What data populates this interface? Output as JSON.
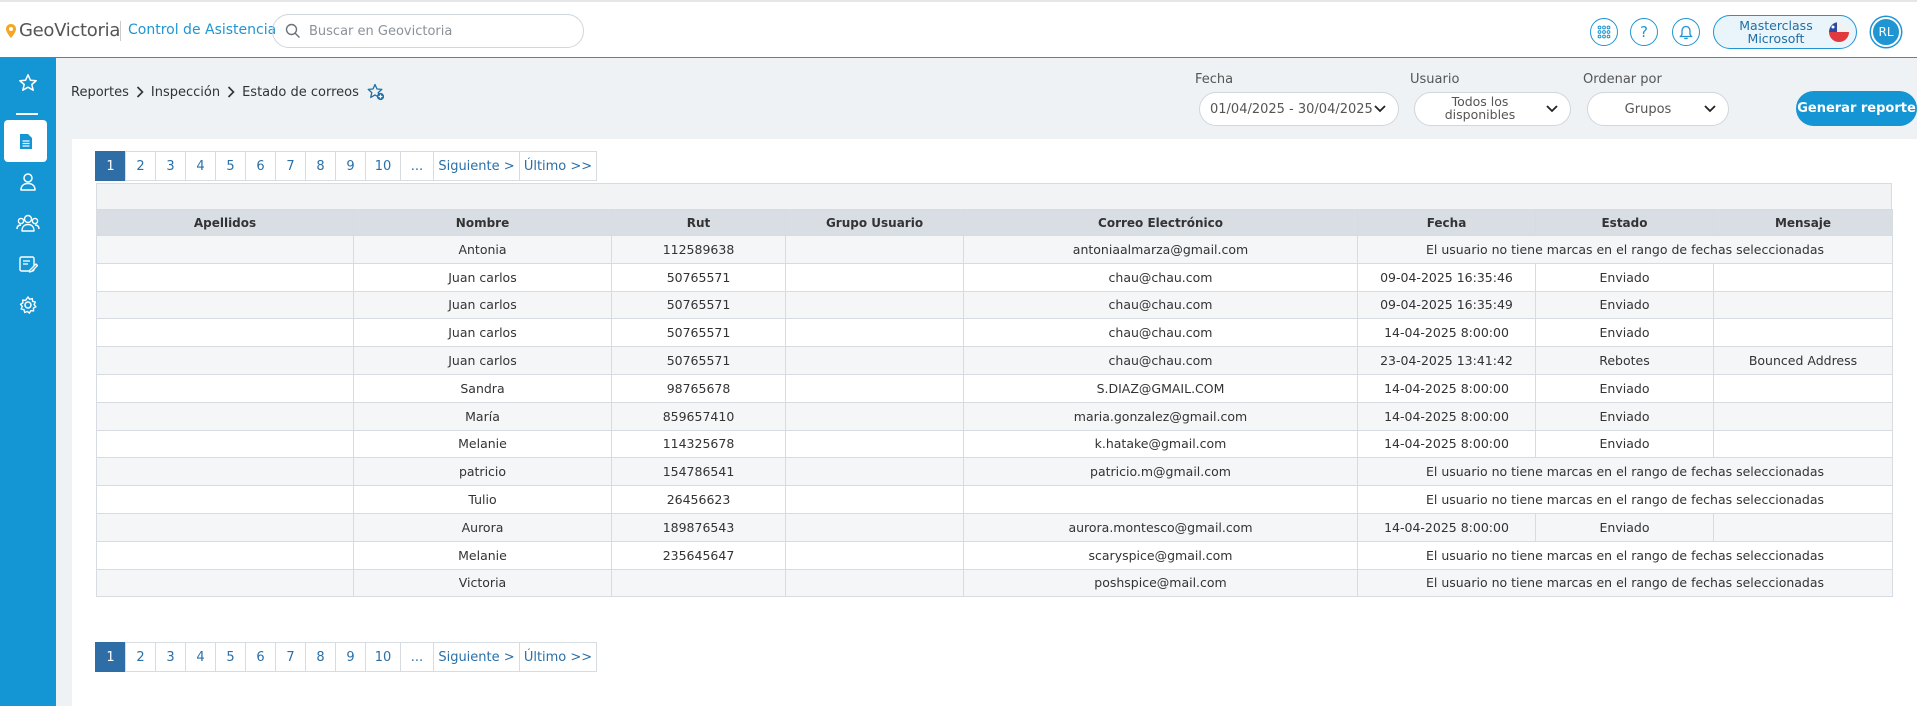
{
  "header": {
    "logo_text": "GeoVictoria",
    "app_name": "Control de Asistencia",
    "search_placeholder": "Buscar en Geovictoria",
    "account_name": "Masterclass Microsoft",
    "avatar_initials": "RL",
    "icons": [
      "apps-grid-icon",
      "help-icon",
      "bell-icon"
    ]
  },
  "sidebar": {
    "items": [
      {
        "name": "favorites",
        "icon": "star-icon"
      },
      {
        "name": "reports",
        "icon": "document-icon",
        "active": true
      },
      {
        "name": "user",
        "icon": "user-icon"
      },
      {
        "name": "groups",
        "icon": "users-icon"
      },
      {
        "name": "schedule-edit",
        "icon": "edit-calendar-icon"
      },
      {
        "name": "settings",
        "icon": "gear-icon"
      }
    ]
  },
  "breadcrumb": [
    "Reportes",
    "Inspección",
    "Estado de correos"
  ],
  "filters": {
    "fecha_label": "Fecha",
    "fecha_value": "01/04/2025 - 30/04/2025",
    "usuario_label": "Usuario",
    "usuario_value": "Todos los disponibles",
    "ordenar_label": "Ordenar por",
    "ordenar_value": "Grupos",
    "generate_label": "Generar reporte"
  },
  "pagination": {
    "pages": [
      "1",
      "2",
      "3",
      "4",
      "5",
      "6",
      "7",
      "8",
      "9",
      "10",
      "..."
    ],
    "current": "1",
    "next_label": "Siguiente >",
    "last_label": "Último >>"
  },
  "table": {
    "columns": [
      "Apellidos",
      "Nombre",
      "Rut",
      "Grupo Usuario",
      "Correo Electrónico",
      "Fecha",
      "Estado",
      "Mensaje"
    ],
    "rows": [
      {
        "apellidos": "",
        "nombre": "Antonia",
        "rut": "112589638",
        "grupo": "",
        "correo": "antoniaalmarza@gmail.com",
        "note": "El usuario no tiene marcas en el rango de fechas seleccionadas"
      },
      {
        "apellidos": "",
        "nombre": "Juan carlos",
        "rut": "50765571",
        "grupo": "",
        "correo": "chau@chau.com",
        "fecha": "09-04-2025 16:35:46",
        "estado": "Enviado",
        "mensaje": ""
      },
      {
        "apellidos": "",
        "nombre": "Juan carlos",
        "rut": "50765571",
        "grupo": "",
        "correo": "chau@chau.com",
        "fecha": "09-04-2025 16:35:49",
        "estado": "Enviado",
        "mensaje": ""
      },
      {
        "apellidos": "",
        "nombre": "Juan carlos",
        "rut": "50765571",
        "grupo": "",
        "correo": "chau@chau.com",
        "fecha": "14-04-2025 8:00:00",
        "estado": "Enviado",
        "mensaje": ""
      },
      {
        "apellidos": "",
        "nombre": "Juan carlos",
        "rut": "50765571",
        "grupo": "",
        "correo": "chau@chau.com",
        "fecha": "23-04-2025 13:41:42",
        "estado": "Rebotes",
        "mensaje": "Bounced Address"
      },
      {
        "apellidos": "",
        "nombre": "Sandra",
        "rut": "98765678",
        "grupo": "",
        "correo": "S.DIAZ@GMAIL.COM",
        "fecha": "14-04-2025 8:00:00",
        "estado": "Enviado",
        "mensaje": ""
      },
      {
        "apellidos": "",
        "nombre": "María",
        "rut": "859657410",
        "grupo": "",
        "correo": "maria.gonzalez@gmail.com",
        "fecha": "14-04-2025 8:00:00",
        "estado": "Enviado",
        "mensaje": ""
      },
      {
        "apellidos": "",
        "nombre": "Melanie",
        "rut": "114325678",
        "grupo": "",
        "correo": "k.hatake@gmail.com",
        "fecha": "14-04-2025 8:00:00",
        "estado": "Enviado",
        "mensaje": ""
      },
      {
        "apellidos": "",
        "nombre": "patricio",
        "rut": "154786541",
        "grupo": "",
        "correo": "patricio.m@gmail.com",
        "note": "El usuario no tiene marcas en el rango de fechas seleccionadas"
      },
      {
        "apellidos": "",
        "nombre": "Tulio",
        "rut": "26456623",
        "grupo": "",
        "correo": "",
        "note": "El usuario no tiene marcas en el rango de fechas seleccionadas"
      },
      {
        "apellidos": "",
        "nombre": "Aurora",
        "rut": "189876543",
        "grupo": "",
        "correo": "aurora.montesco@gmail.com",
        "fecha": "14-04-2025 8:00:00",
        "estado": "Enviado",
        "mensaje": ""
      },
      {
        "apellidos": "",
        "nombre": "Melanie",
        "rut": "235645647",
        "grupo": "",
        "correo": "scaryspice@gmail.com",
        "note": "El usuario no tiene marcas en el rango de fechas seleccionadas"
      },
      {
        "apellidos": "",
        "nombre": "Victoria",
        "rut": "",
        "grupo": "",
        "correo": "poshspice@mail.com",
        "note": "El usuario no tiene marcas en el rango de fechas seleccionadas"
      }
    ]
  },
  "colors": {
    "primary": "#1496d4",
    "pager_active": "#2f6da6",
    "table_header": "#d9dee5"
  }
}
